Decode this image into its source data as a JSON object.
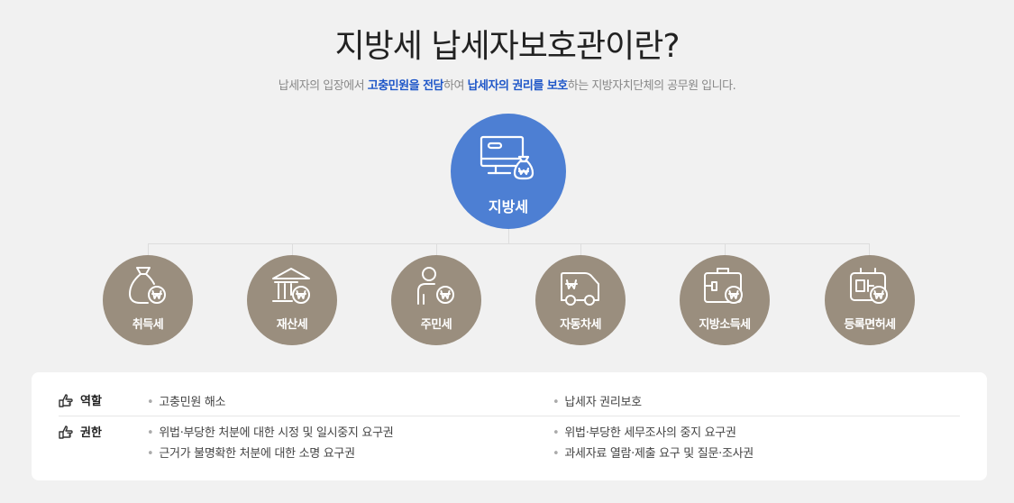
{
  "header": {
    "title": "지방세 납세자보호관이란?",
    "subtitle": {
      "p1": "납세자의 입장에서 ",
      "h1": "고충민원을 전담",
      "p2": "하여 ",
      "h2": "납세자의 권리를 보호",
      "p3": "하는 지방자치단체의 공무원 입니다."
    }
  },
  "main_node": {
    "label": "지방세",
    "icon": "local-tax-icon",
    "color": "#4d7fd3"
  },
  "sub_nodes": [
    {
      "label": "취득세",
      "icon": "money-bag-icon"
    },
    {
      "label": "재산세",
      "icon": "building-icon"
    },
    {
      "label": "주민세",
      "icon": "person-icon"
    },
    {
      "label": "자동차세",
      "icon": "car-icon"
    },
    {
      "label": "지방소득세",
      "icon": "briefcase-icon"
    },
    {
      "label": "등록면허세",
      "icon": "license-icon"
    }
  ],
  "sub_color": "#9a8e7e",
  "info": {
    "role": {
      "heading": "역할",
      "items": [
        "고충민원 해소",
        "납세자 권리보호"
      ]
    },
    "authority": {
      "heading": "권한",
      "items": [
        "위법·부당한 처분에 대한 시정 및 일시중지 요구권",
        "위법·부당한 세무조사의 중지 요구권",
        "근거가 불명확한 처분에 대한 소명 요구권",
        "과세자료 열람·제출 요구 및 질문·조사권"
      ]
    }
  },
  "accent": "#1e56c8"
}
